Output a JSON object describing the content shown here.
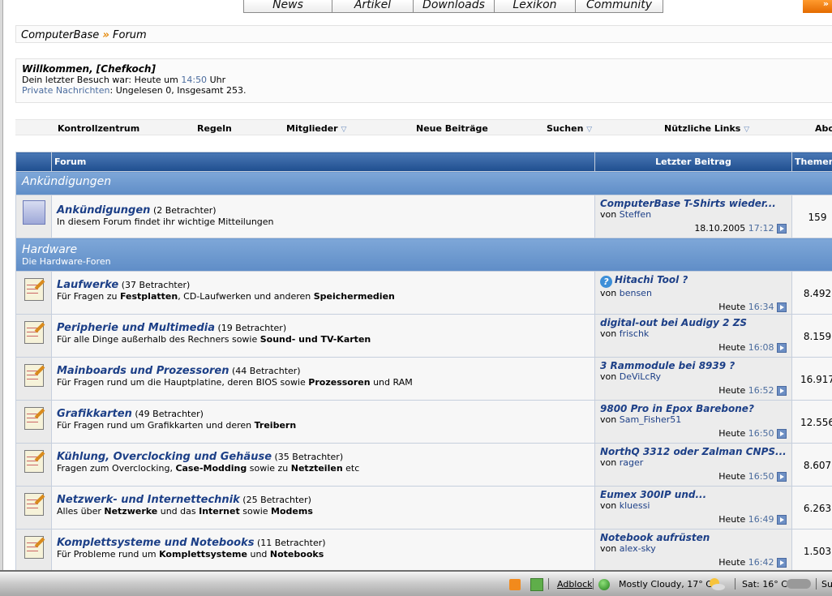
{
  "topnav": [
    "News",
    "Artikel",
    "Downloads",
    "Lexikon",
    "Community"
  ],
  "corner_label": "»",
  "breadcrumb": {
    "home": "ComputerBase",
    "sep": "»",
    "current": "Forum"
  },
  "welcome": {
    "greeting": "Willkommen, [Chefkoch]",
    "last_visit_prefix": "Dein letzter Besuch war: Heute um",
    "last_visit_time": "14:50",
    "last_visit_suffix": "Uhr",
    "pm_link": "Private Nachrichten",
    "pm_text": ": Ungelesen 0, Insgesamt 253."
  },
  "quicknav": {
    "cp": "Kontrollzentrum",
    "rules": "Regeln",
    "members": "Mitglieder",
    "new_posts": "Neue Beiträge",
    "search": "Suchen",
    "links": "Nützliche Links",
    "abo": "Abo",
    "dropdown_glyph": "▽"
  },
  "table": {
    "col_forum": "Forum",
    "col_last": "Letzter Beitrag",
    "col_topics": "Themen"
  },
  "categories": {
    "ankuendigungen": {
      "name": "Ankündigungen"
    },
    "hardware": {
      "name": "Hardware",
      "desc": "Die Hardware-Foren"
    }
  },
  "forums": [
    {
      "name": "Ankündigungen",
      "viewers": "(2 Betrachter)",
      "desc": "In diesem Forum findet ihr wichtige Mitteilungen",
      "last_title": "ComputerBase T-Shirts wieder...",
      "by": "von",
      "user": "Steffen",
      "date": "18.10.2005",
      "time": "17:12",
      "topics": "159"
    },
    {
      "name": "Laufwerke",
      "viewers": "(37 Betrachter)",
      "d1": "Für Fragen zu ",
      "b1": "Festplatten",
      "d2": ", CD-Laufwerken und anderen ",
      "b2": "Speichermedien",
      "d3": "",
      "last_title": "Hitachi Tool ?",
      "by": "von",
      "user": "bensen",
      "date": "Heute",
      "time": "16:34",
      "topics": "8.492"
    },
    {
      "name": "Peripherie und Multimedia",
      "viewers": "(19 Betrachter)",
      "d1": "Für alle Dinge außerhalb des Rechners sowie ",
      "b1": "Sound- und TV-Karten",
      "d2": "",
      "b2": "",
      "d3": "",
      "last_title": "digital-out bei Audigy 2 ZS",
      "by": "von",
      "user": "frischk",
      "date": "Heute",
      "time": "16:08",
      "topics": "8.159"
    },
    {
      "name": "Mainboards und Prozessoren",
      "viewers": "(44 Betrachter)",
      "d1": "Für Fragen rund um die Hauptplatine, deren BIOS sowie ",
      "b1": "Prozessoren",
      "d2": " und RAM",
      "b2": "",
      "d3": "",
      "last_title": "3 Rammodule bei 8939 ?",
      "by": "von",
      "user": "DeViLcRy",
      "date": "Heute",
      "time": "16:52",
      "topics": "16.917"
    },
    {
      "name": "Grafikkarten",
      "viewers": "(49 Betrachter)",
      "d1": "Für Fragen rund um Grafikkarten und deren ",
      "b1": "Treibern",
      "d2": "",
      "b2": "",
      "d3": "",
      "last_title": "9800 Pro in Epox Barebone?",
      "by": "von",
      "user": "Sam_Fisher51",
      "date": "Heute",
      "time": "16:50",
      "topics": "12.556"
    },
    {
      "name": "Kühlung, Overclocking und Gehäuse",
      "viewers": "(35 Betrachter)",
      "d1": "Fragen zum Overclocking, ",
      "b1": "Case-Modding",
      "d2": " sowie zu ",
      "b2": "Netzteilen",
      "d3": " etc",
      "last_title": "NorthQ 3312 oder Zalman CNPS...",
      "by": "von",
      "user": "rager",
      "date": "Heute",
      "time": "16:50",
      "topics": "8.607"
    },
    {
      "name": "Netzwerk- und Internettechnik",
      "viewers": "(25 Betrachter)",
      "d1": "Alles über ",
      "b1": "Netzwerke",
      "d2": " und das ",
      "b2": "Internet",
      "d3": " sowie ",
      "b3": "Modems",
      "last_title": "Eumex 300IP und...",
      "by": "von",
      "user": "kluessi",
      "date": "Heute",
      "time": "16:49",
      "topics": "6.263"
    },
    {
      "name": "Komplettsysteme und Notebooks",
      "viewers": "(11 Betrachter)",
      "d1": "Für Probleme rund um ",
      "b1": "Komplettsysteme",
      "d2": " und ",
      "b2": "Notebooks",
      "d3": "",
      "last_title": "Notebook aufrüsten",
      "by": "von",
      "user": "alex-sky",
      "date": "Heute",
      "time": "16:42",
      "topics": "1.503"
    }
  ],
  "taskbar": {
    "adblock": "Adblock",
    "weather": "Mostly Cloudy, 17° C",
    "forecast": "Sat: 16° C",
    "cut": "Su"
  }
}
